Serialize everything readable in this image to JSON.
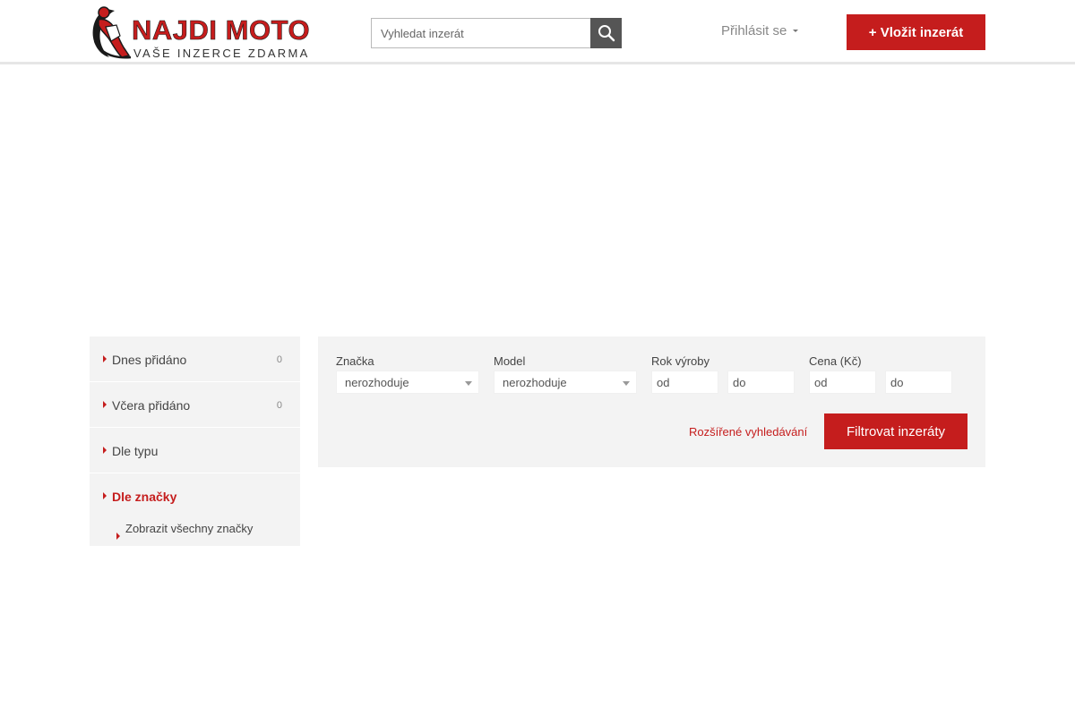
{
  "header": {
    "logo_title": "NAJDI MOTO",
    "logo_subtitle": "VAŠE INZERCE ZDARMA",
    "search_placeholder": "Vyhledat inzerát",
    "search_icon": "search-icon",
    "login_label": "Přihlásit se",
    "add_listing_label": "+ Vložit inzerát"
  },
  "colors": {
    "brand_red": "#c51d1d",
    "panel_gray": "#f3f3f3",
    "search_button": "#555555"
  },
  "sidebar": {
    "items": [
      {
        "label": "Dnes přidáno",
        "count": "0"
      },
      {
        "label": "Včera přidáno",
        "count": "0"
      },
      {
        "label": "Dle typu"
      },
      {
        "label": "Dle značky",
        "active": true
      }
    ],
    "sub_items": [
      {
        "label": "Zobrazit všechny značky"
      }
    ]
  },
  "filter": {
    "brand": {
      "label": "Značka",
      "value": "nerozhoduje"
    },
    "model": {
      "label": "Model",
      "value": "nerozhoduje"
    },
    "year": {
      "label": "Rok výroby",
      "from_placeholder": "od",
      "to_placeholder": "do"
    },
    "price": {
      "label": "Cena (Kč)",
      "from_placeholder": "od",
      "to_placeholder": "do"
    },
    "advanced_link": "Rozšířené vyhledávání",
    "submit_label": "Filtrovat inzeráty"
  }
}
